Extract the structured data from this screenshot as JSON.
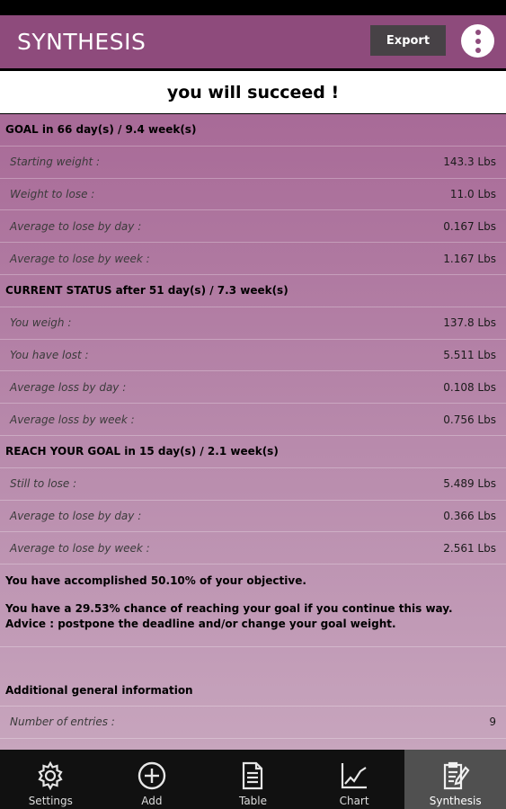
{
  "header": {
    "title": "SYNTHESIS",
    "export_label": "Export"
  },
  "banner": "you will succeed !",
  "goal": {
    "heading": "GOAL in 66 day(s) / 9.4 week(s)",
    "rows": [
      {
        "label": "Starting weight :",
        "value": "143.3 Lbs"
      },
      {
        "label": "Weight to lose :",
        "value": "11.0 Lbs"
      },
      {
        "label": "Average to lose by day :",
        "value": "0.167 Lbs"
      },
      {
        "label": "Average to lose by week :",
        "value": "1.167 Lbs"
      }
    ]
  },
  "current": {
    "heading": "CURRENT STATUS after 51 day(s) / 7.3 week(s)",
    "rows": [
      {
        "label": "You weigh :",
        "value": "137.8 Lbs"
      },
      {
        "label": "You have lost :",
        "value": "5.511 Lbs"
      },
      {
        "label": "Average loss by day :",
        "value": "0.108 Lbs"
      },
      {
        "label": "Average loss by week :",
        "value": "0.756 Lbs"
      }
    ]
  },
  "reach": {
    "heading": "REACH YOUR GOAL in 15 day(s) / 2.1 week(s)",
    "rows": [
      {
        "label": "Still to lose :",
        "value": "5.489 Lbs"
      },
      {
        "label": "Average to lose by day :",
        "value": "0.366 Lbs"
      },
      {
        "label": "Average to lose by week :",
        "value": "2.561 Lbs"
      }
    ]
  },
  "accomplished": "You have accomplished 50.10% of your objective.",
  "chance": "You have a 29.53% chance of reaching your goal if you continue this way.",
  "advice": "Advice : postpone the deadline and/or change your goal weight.",
  "additional": {
    "heading": "Additional general information",
    "rows": [
      {
        "label": "Number of entries :",
        "value": "9"
      }
    ]
  },
  "tabs": [
    {
      "label": "Settings",
      "icon": "gear-icon"
    },
    {
      "label": "Add",
      "icon": "plus-circle-icon"
    },
    {
      "label": "Table",
      "icon": "document-icon"
    },
    {
      "label": "Chart",
      "icon": "chart-icon"
    },
    {
      "label": "Synthesis",
      "icon": "clipboard-pencil-icon",
      "active": true
    }
  ],
  "colors": {
    "header": "#8e4b7c",
    "tabbar": "#111111",
    "active_tab": "#505050"
  }
}
